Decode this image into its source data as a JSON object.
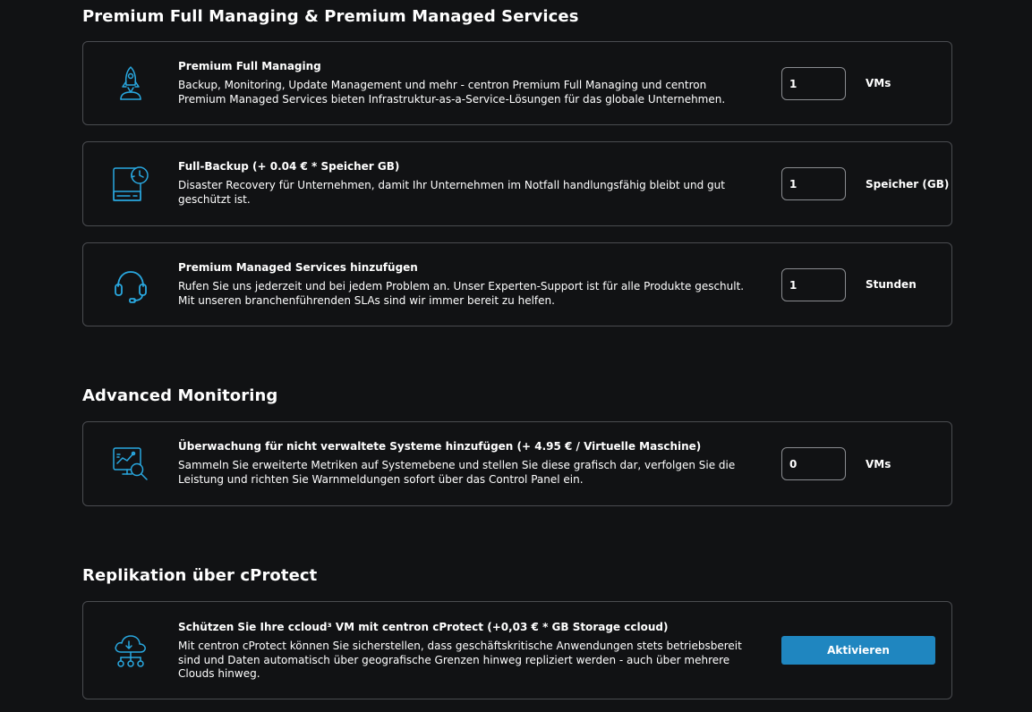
{
  "sections": {
    "premium": {
      "title": "Premium Full Managing & Premium Managed Services",
      "items": [
        {
          "icon": "rocket-icon",
          "title": "Premium Full Managing",
          "description": "Backup, Monitoring, Update Management und mehr - centron Premium Full Managing und centron Premium Managed Services bieten Infrastruktur-as-a-Service-Lösungen für das globale Unternehmen.",
          "value": "1",
          "unit": "VMs"
        },
        {
          "icon": "backup-server-icon",
          "title": "Full-Backup (+ 0.04 € * Speicher GB)",
          "description": "Disaster Recovery für Unternehmen, damit Ihr Unternehmen im Notfall handlungsfähig bleibt und gut geschützt ist.",
          "value": "1",
          "unit": "Speicher (GB)"
        },
        {
          "icon": "headset-icon",
          "title": "Premium Managed Services hinzufügen",
          "description": "Rufen Sie uns jederzeit und bei jedem Problem an. Unser Experten-Support ist für alle Produkte geschult. Mit unseren branchenführenden SLAs sind wir immer bereit zu helfen.",
          "value": "1",
          "unit": "Stunden"
        }
      ]
    },
    "monitoring": {
      "title": "Advanced Monitoring",
      "items": [
        {
          "icon": "monitoring-icon",
          "title": "Überwachung für nicht verwaltete Systeme hinzufügen (+ 4.95 € / Virtuelle Maschine)",
          "description": "Sammeln Sie erweiterte Metriken auf Systemebene und stellen Sie diese grafisch dar, verfolgen Sie die Leistung und richten Sie Warnmeldungen sofort über das Control Panel ein.",
          "value": "0",
          "unit": "VMs"
        }
      ]
    },
    "replication": {
      "title": "Replikation über cProtect",
      "items": [
        {
          "icon": "cloud-network-icon",
          "title": "Schützen Sie Ihre ccloud³ VM mit centron cProtect (+0,03 € * GB Storage ccloud)",
          "description": "Mit centron cProtect können Sie sicherstellen, dass geschäftskritische Anwendungen stets betriebsbereit sind und Daten automatisch über geografische Grenzen hinweg repliziert werden - auch über mehrere Clouds hinweg.",
          "button_label": "Aktivieren"
        }
      ]
    }
  },
  "colors": {
    "background": "#111214",
    "border": "#4a4c50",
    "icon_accent": "#29a8e0",
    "button": "#1f86c0",
    "text": "#ffffff"
  }
}
